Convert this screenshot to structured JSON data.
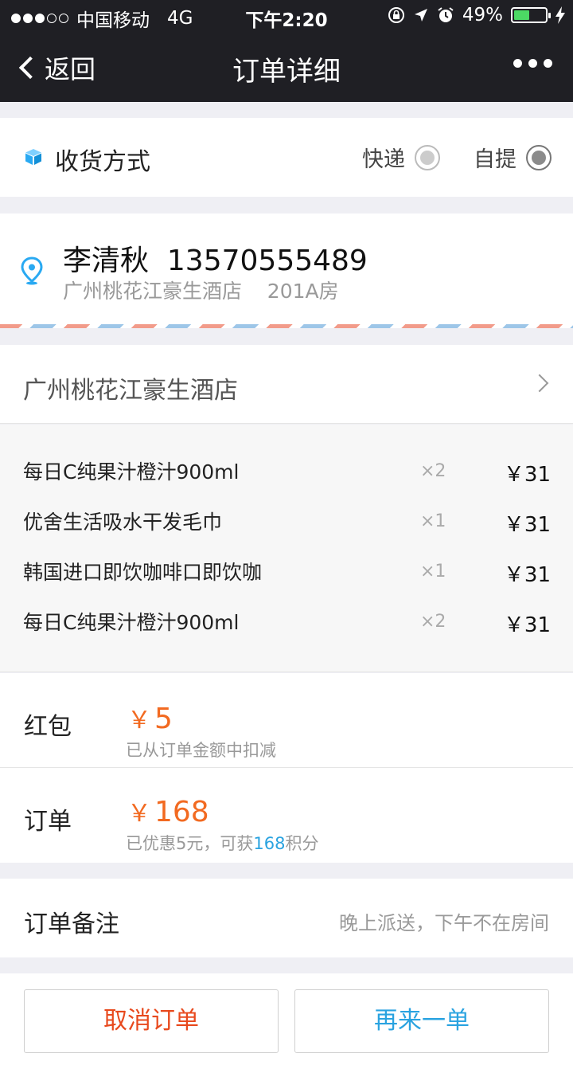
{
  "status_bar": {
    "carrier": "中国移动",
    "network": "4G",
    "time": "下午2:20",
    "battery": "49%",
    "battery_level": 0.49,
    "battery_color": "#4cd964"
  },
  "nav": {
    "back_label": "返回",
    "title": "订单详细",
    "more_icon": "ellipsis-icon"
  },
  "delivery": {
    "label": "收货方式",
    "icon": "box-icon",
    "options": [
      {
        "label": "快递",
        "selected": false
      },
      {
        "label": "自提",
        "selected": true
      }
    ]
  },
  "address": {
    "icon": "location-pin-icon",
    "name_phone": "李清秋  13570555489",
    "detail": "广州桃花江豪生酒店    201A房"
  },
  "store": {
    "name": "广州桃花江豪生酒店"
  },
  "items": [
    {
      "name": "每日C纯果汁橙汁900ml",
      "qty": "×2",
      "price": "￥31"
    },
    {
      "name": "优舍生活吸水干发毛巾",
      "qty": "×1",
      "price": "￥31"
    },
    {
      "name": "韩国进口即饮咖啡口即饮咖",
      "qty": "×1",
      "price": "￥31"
    },
    {
      "name": "每日C纯果汁橙汁900ml",
      "qty": "×2",
      "price": "￥31"
    }
  ],
  "red_packet": {
    "label": "红包",
    "currency": "￥",
    "amount": "5",
    "note": "已从订单金额中扣减"
  },
  "order": {
    "label": "订单",
    "currency": "￥",
    "amount": "168",
    "note_prefix": "已优惠5元，可获",
    "points": "168",
    "note_suffix": "积分"
  },
  "remark": {
    "label": "订单备注",
    "value": "晚上派送，下午不在房间"
  },
  "actions": {
    "cancel_label": "取消订单",
    "reorder_label": "再来一单"
  },
  "colors": {
    "accent_orange": "#f26a21",
    "accent_blue": "#2aa3e0",
    "cancel_red": "#e8491d"
  }
}
